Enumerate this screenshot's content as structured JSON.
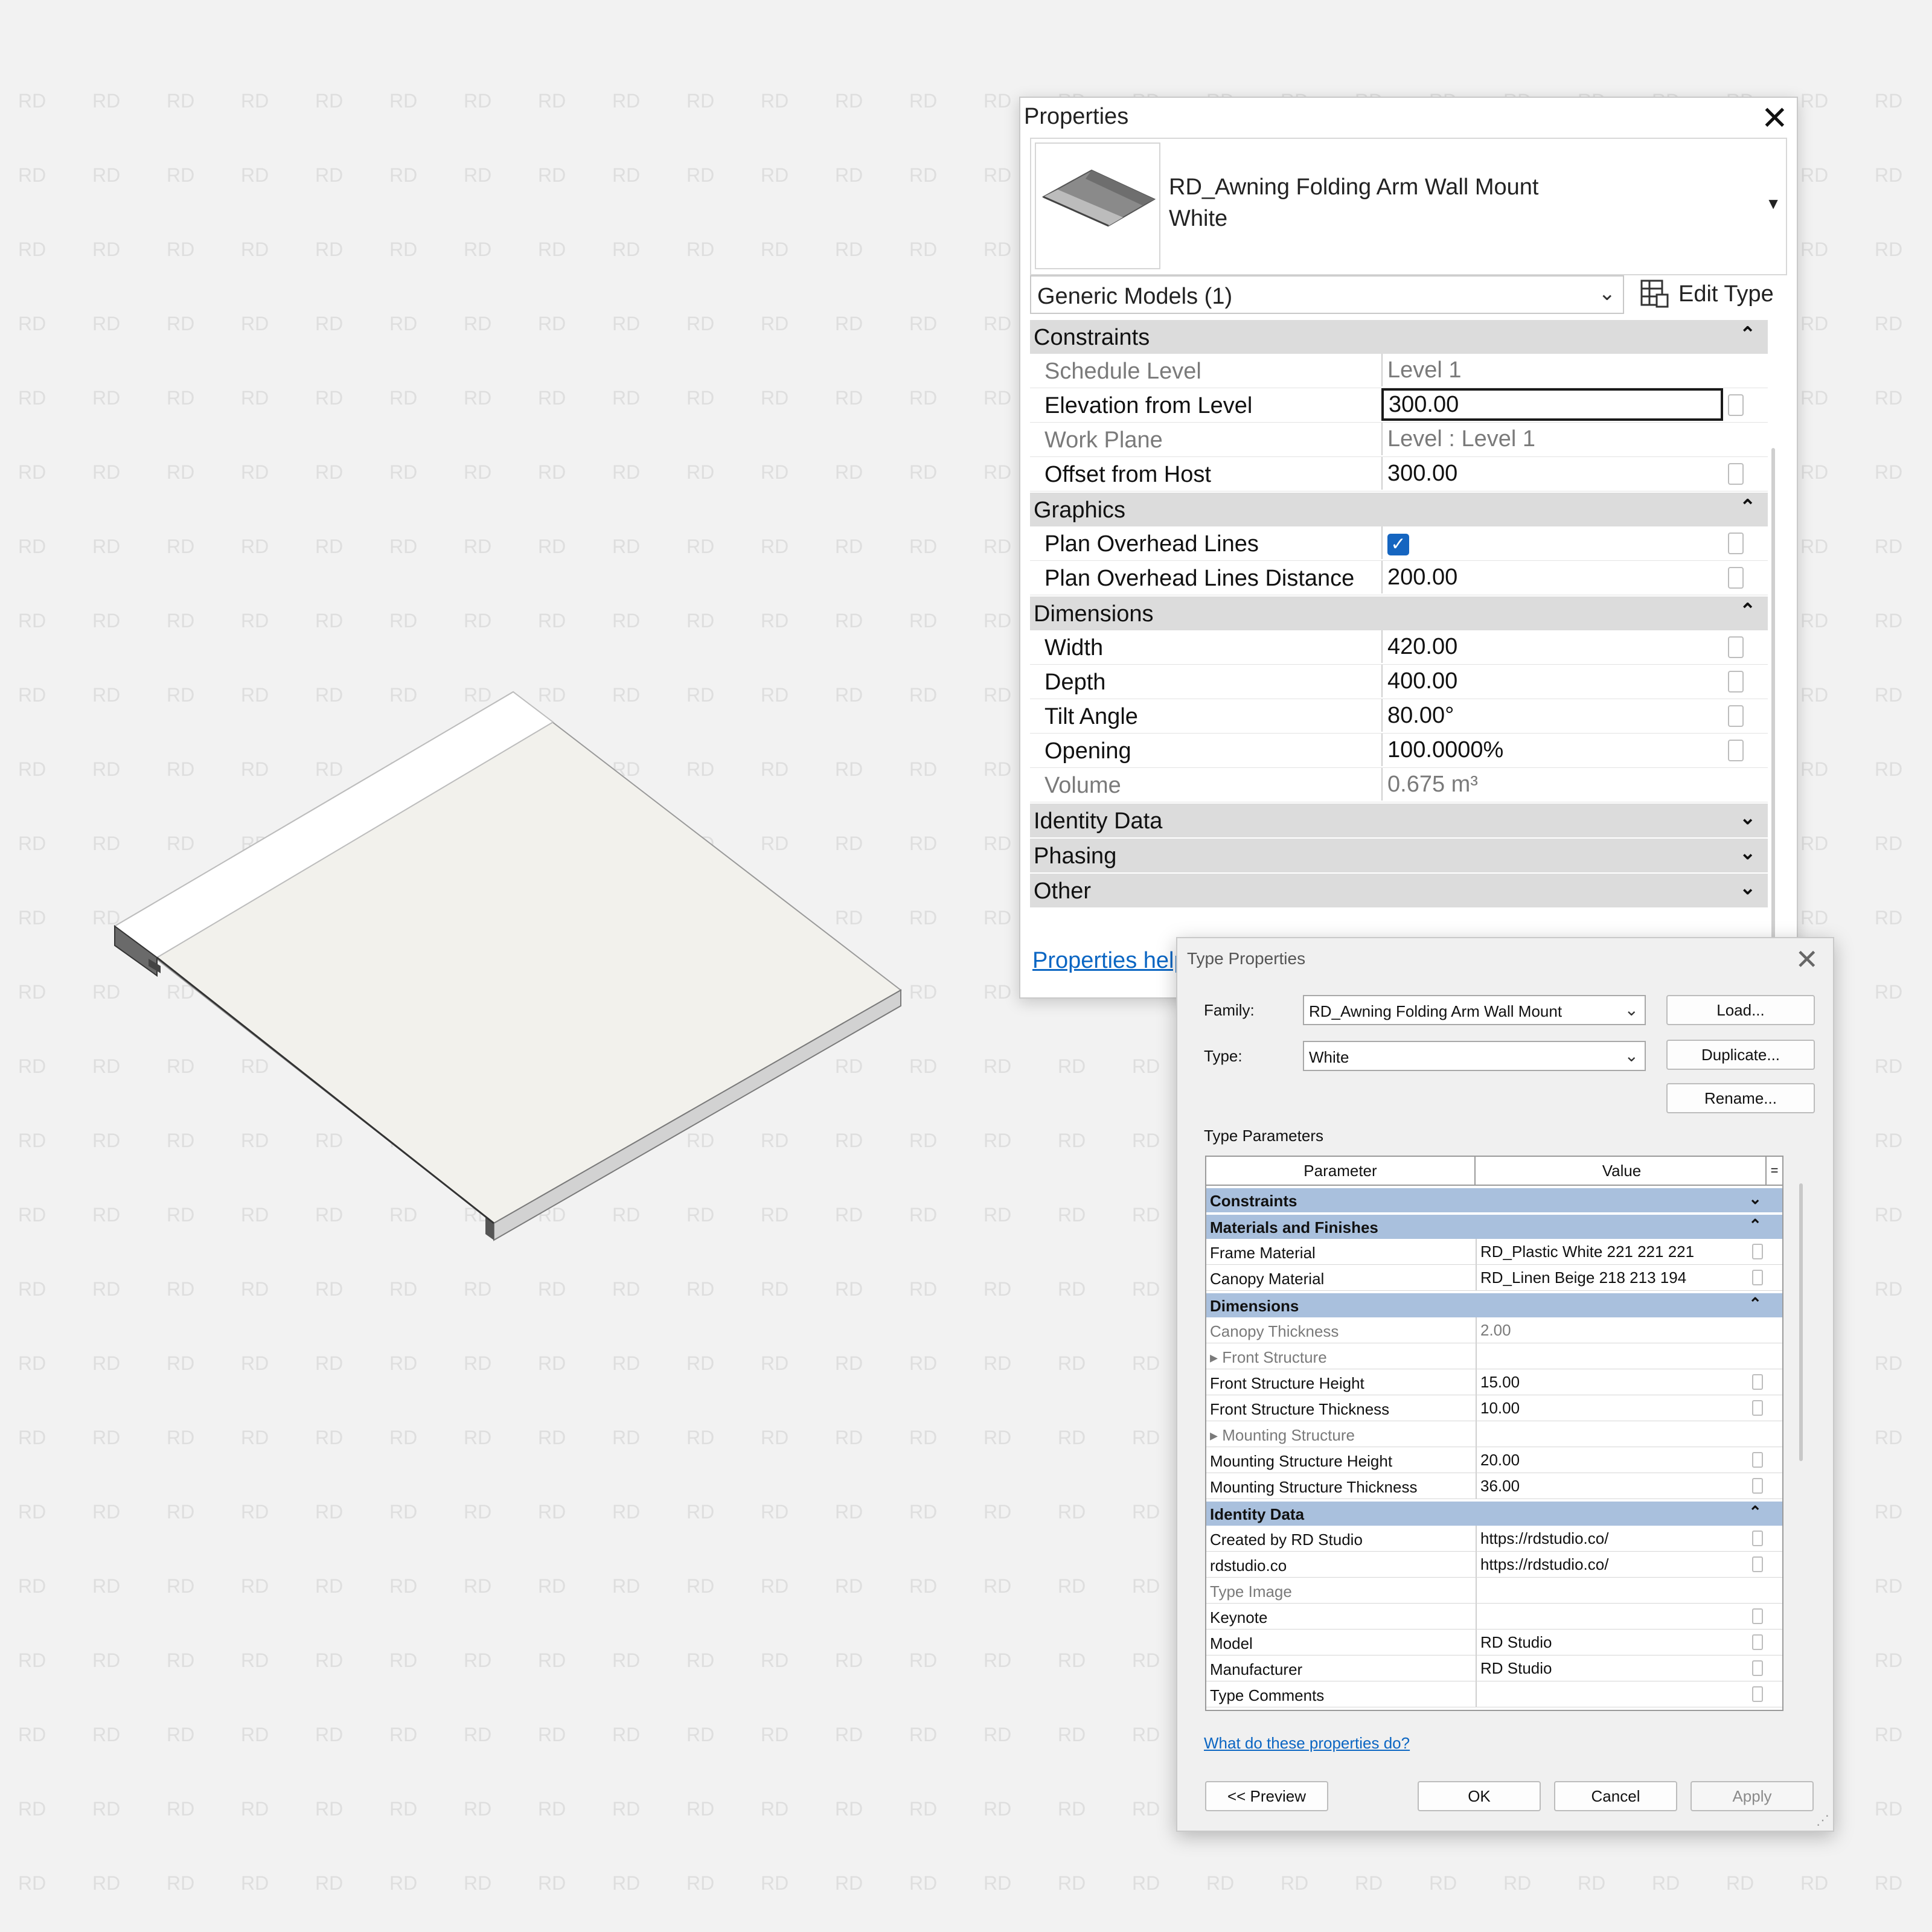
{
  "watermark_text": "RD",
  "properties": {
    "title": "Properties",
    "close_icon": "close-icon",
    "type_name_line1": "RD_Awning Folding Arm Wall Mount",
    "type_name_line2": "White",
    "category_selector": "Generic Models (1)",
    "edit_type_label": "Edit Type",
    "groups": [
      {
        "name": "Constraints",
        "expanded": true,
        "rows": [
          {
            "name": "Schedule Level",
            "value": "Level 1",
            "readonly": true
          },
          {
            "name": "Elevation from Level",
            "value": "300.00",
            "readonly": false,
            "active": true
          },
          {
            "name": "Work Plane",
            "value": "Level : Level 1",
            "readonly": true
          },
          {
            "name": "Offset from Host",
            "value": "300.00",
            "readonly": false
          }
        ]
      },
      {
        "name": "Graphics",
        "expanded": true,
        "rows": [
          {
            "name": "Plan Overhead Lines",
            "value": "",
            "checkbox": true,
            "checked": true
          },
          {
            "name": "Plan Overhead Lines Distance",
            "value": "200.00",
            "readonly": false
          }
        ]
      },
      {
        "name": "Dimensions",
        "expanded": true,
        "rows": [
          {
            "name": "Width",
            "value": "420.00",
            "readonly": false
          },
          {
            "name": "Depth",
            "value": "400.00",
            "readonly": false
          },
          {
            "name": "Tilt Angle",
            "value": "80.00°",
            "readonly": false
          },
          {
            "name": "Opening",
            "value": "100.0000%",
            "readonly": false
          },
          {
            "name": "Volume",
            "value": "0.675 m³",
            "readonly": true
          }
        ]
      },
      {
        "name": "Identity Data",
        "expanded": false,
        "rows": []
      },
      {
        "name": "Phasing",
        "expanded": false,
        "rows": []
      },
      {
        "name": "Other",
        "expanded": false,
        "rows": []
      }
    ],
    "help_link": "Properties help"
  },
  "type_properties": {
    "title": "Type Properties",
    "family_label": "Family:",
    "family_value": "RD_Awning Folding Arm Wall Mount",
    "type_label": "Type:",
    "type_value": "White",
    "load_button": "Load...",
    "duplicate_button": "Duplicate...",
    "rename_button": "Rename...",
    "section_label": "Type Parameters",
    "col_parameter": "Parameter",
    "col_value": "Value",
    "col_btn": "=",
    "groups": [
      {
        "name": "Constraints",
        "expanded": false,
        "rows": []
      },
      {
        "name": "Materials and Finishes",
        "expanded": true,
        "rows": [
          {
            "name": "Frame Material",
            "value": "RD_Plastic White 221 221 221"
          },
          {
            "name": "Canopy Material",
            "value": "RD_Linen Beige 218 213 194"
          }
        ]
      },
      {
        "name": "Dimensions",
        "expanded": true,
        "rows": [
          {
            "name": "Canopy Thickness",
            "value": "2.00",
            "readonly": true
          },
          {
            "name": "▸ Front Structure",
            "value": "",
            "readonly": true,
            "noassoc": true
          },
          {
            "name": "Front Structure Height",
            "value": "15.00"
          },
          {
            "name": "Front Structure Thickness",
            "value": "10.00"
          },
          {
            "name": "▸ Mounting Structure",
            "value": "",
            "readonly": true,
            "noassoc": true
          },
          {
            "name": "Mounting Structure Height",
            "value": "20.00"
          },
          {
            "name": "Mounting Structure Thickness",
            "value": "36.00"
          }
        ]
      },
      {
        "name": "Identity Data",
        "expanded": true,
        "rows": [
          {
            "name": "Created by RD Studio",
            "value": "https://rdstudio.co/"
          },
          {
            "name": "rdstudio.co",
            "value": "https://rdstudio.co/"
          },
          {
            "name": "Type Image",
            "value": "",
            "readonly": true,
            "noassoc": true
          },
          {
            "name": "Keynote",
            "value": ""
          },
          {
            "name": "Model",
            "value": "RD Studio"
          },
          {
            "name": "Manufacturer",
            "value": "RD Studio"
          },
          {
            "name": "Type Comments",
            "value": ""
          }
        ]
      }
    ],
    "help_link": "What do these properties do?",
    "preview_button": "<< Preview",
    "ok_button": "OK",
    "cancel_button": "Cancel",
    "apply_button": "Apply"
  },
  "colors": {
    "background": "#f2f2f2",
    "group_header": "#dcdcdc",
    "type_group_header": "#a9c0dd",
    "link": "#0b66c3",
    "checkbox": "#1565c0",
    "canopy": "#f2f1ec"
  }
}
